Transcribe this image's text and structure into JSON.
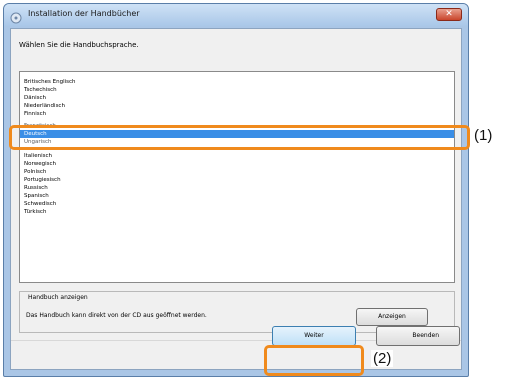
{
  "window": {
    "title": "Installation der Handbücher",
    "close_glyph": "✕"
  },
  "prompt": "Wählen Sie die Handbuchsprache.",
  "languages": [
    "Britisches Englisch",
    "Tschechisch",
    "Dänisch",
    "Niederländisch",
    "Finnisch",
    "Französisch",
    "Deutsch",
    "Ungarisch",
    "Italienisch",
    "Norwegisch",
    "Polnisch",
    "Portugiesisch",
    "Russisch",
    "Spanisch",
    "Schwedisch",
    "Türkisch"
  ],
  "selected_language": "Deutsch",
  "manual_group": {
    "label": "Handbuch anzeigen",
    "description": "Das Handbuch kann direkt von der CD aus geöffnet werden.",
    "show_button": "Anzeigen"
  },
  "buttons": {
    "next": "Weiter",
    "end": "Beenden"
  },
  "callouts": {
    "one": "(1)",
    "two": "(2)"
  },
  "colors": {
    "highlight": "#f08a1c",
    "selection": "#3a8ee6"
  }
}
